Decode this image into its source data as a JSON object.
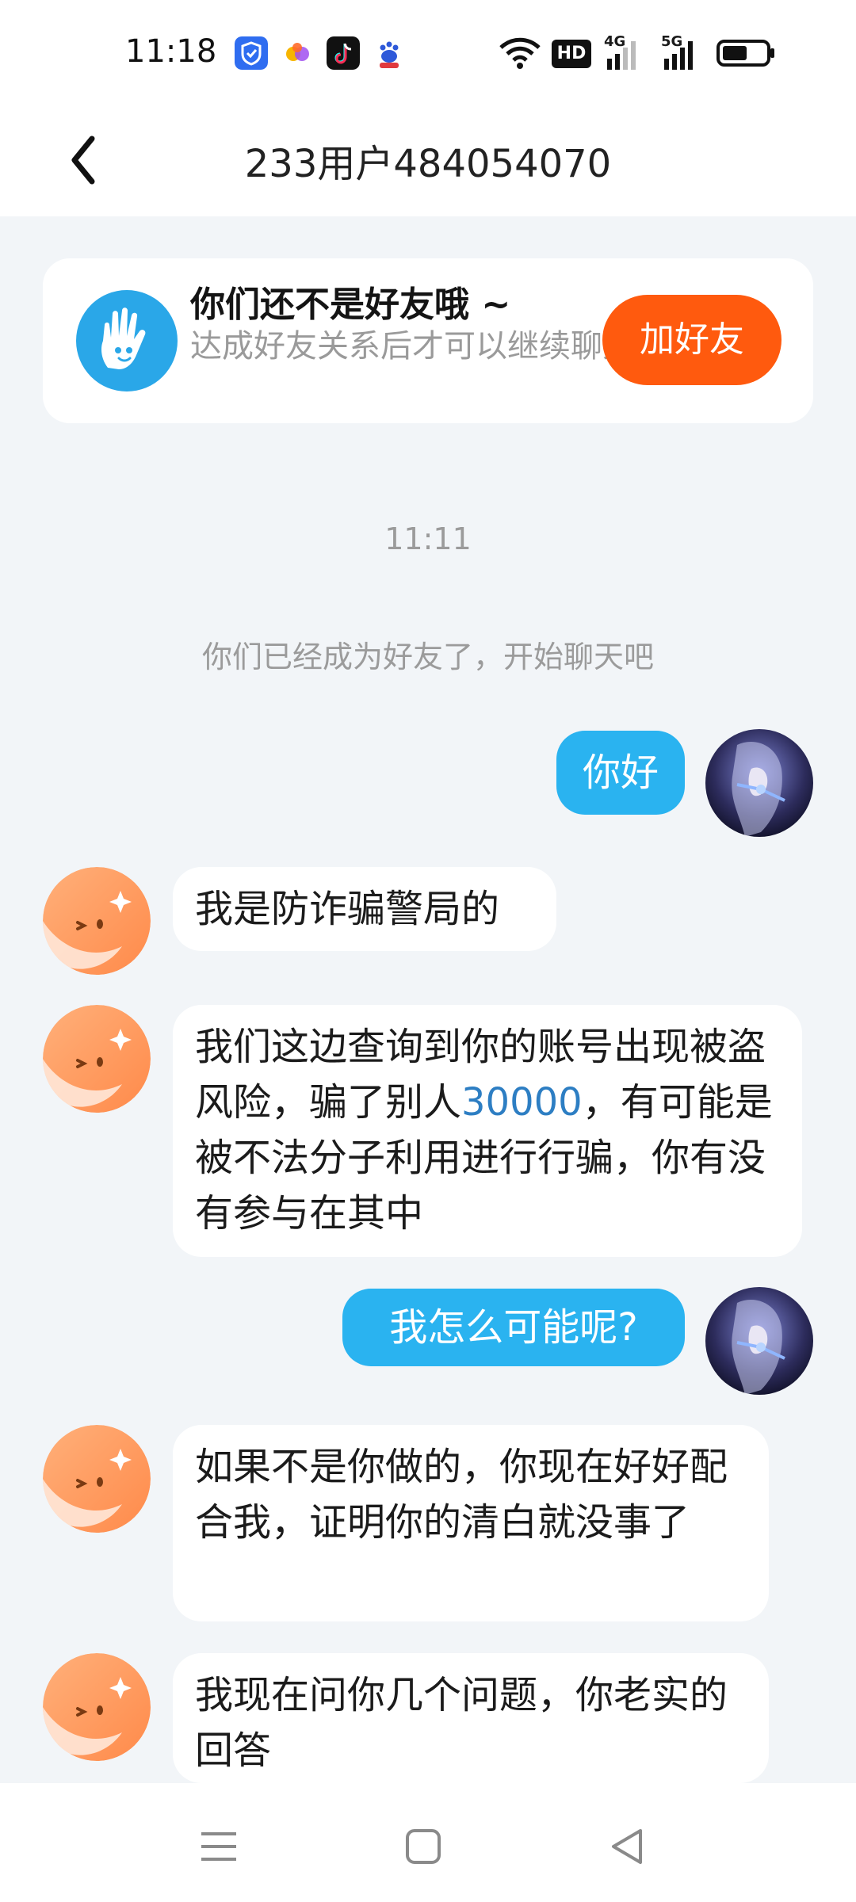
{
  "status_bar": {
    "time": "11:18",
    "app_icons": [
      "shield-app-icon",
      "colorful-app-icon",
      "tiktok-icon",
      "baidu-icon"
    ],
    "indicators": {
      "hd": "HD",
      "net1": "4G",
      "net2": "5G"
    }
  },
  "header": {
    "title": "233用户484054070",
    "back_icon": "back-chevron-icon"
  },
  "friend_banner": {
    "heading": "你们还不是好友哦 ~",
    "description": "达成好友关系后才可以继续聊天",
    "button_label": "加好友",
    "icon": "hand-icon"
  },
  "chat": {
    "timestamp": "11:11",
    "system_notice": "你们已经成为好友了，开始聊天吧",
    "messages": [
      {
        "from": "me",
        "text": "你好"
      },
      {
        "from": "them",
        "text": "我是防诈骗警局的"
      },
      {
        "from": "them",
        "text_pre": "我们这边查询到你的账号出现被盗风险，骗了别人",
        "text_highlight": "30000",
        "text_post": "，有可能是被不法分子利用进行行骗，你有没有参与在其中"
      },
      {
        "from": "me",
        "text": "我怎么可能呢?"
      },
      {
        "from": "them",
        "text": "如果不是你做的，你现在好好配合我，证明你的清白就没事了"
      },
      {
        "from": "them",
        "text": "我现在问你几个问题，你老实的回答"
      }
    ]
  },
  "nav_bar": {
    "buttons": [
      "menu-icon",
      "home-square-icon",
      "back-triangle-icon"
    ]
  },
  "colors": {
    "accent_blue": "#2ab3f0",
    "add_button": "#ff5a0e",
    "highlight_number": "#2d7ec3",
    "background": "#f2f5f8"
  }
}
